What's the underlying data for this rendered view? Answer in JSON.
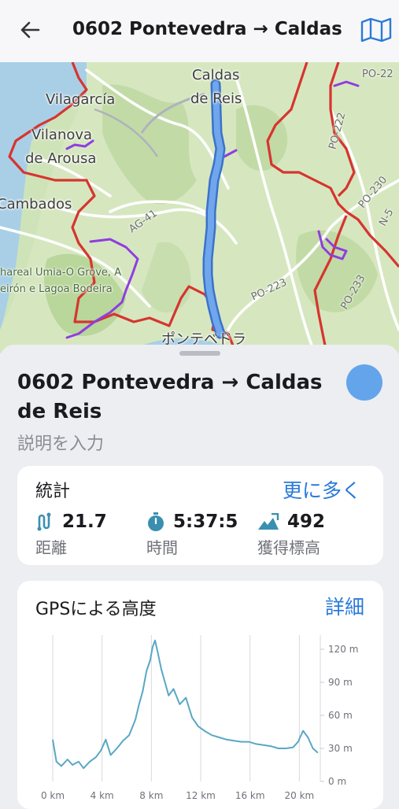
{
  "header": {
    "title": "0602 Pontevedra → Caldas de Reis",
    "back_icon": "arrow-left-icon",
    "map_icon": "map-icon"
  },
  "map": {
    "places": [
      {
        "name": "Caldas"
      },
      {
        "name": "de Reis"
      },
      {
        "name": "Vilagarcía"
      },
      {
        "name": "Vilanova"
      },
      {
        "name": "de Arousa"
      },
      {
        "name": "Cambados"
      },
      {
        "name": "ポンテベドラ"
      }
    ],
    "roads": [
      "PO-22",
      "PO-222",
      "PO-230",
      "N-5",
      "AG-41",
      "PO-223",
      "PO-233"
    ],
    "area_labels": [
      "hareal Umia-O Grove, A",
      "eirón e Lagoa Bodeira"
    ]
  },
  "sheet": {
    "track_name": "0602 Pontevedra → Caldas de Reis",
    "description_placeholder": "説明を入力",
    "color": "#64a4ea"
  },
  "stats": {
    "title": "統計",
    "more_link": "更に多く",
    "distance": {
      "value": "21.7",
      "label": "距離",
      "icon": "route-icon"
    },
    "time": {
      "value": "5:37:5",
      "label": "時間",
      "icon": "stopwatch-icon"
    },
    "ascent": {
      "value": "492",
      "label": "獲得標高",
      "icon": "ascent-icon"
    }
  },
  "elevation": {
    "title": "GPSによる高度",
    "details_link": "詳細"
  },
  "chart_data": {
    "type": "line",
    "x_unit": "km",
    "y_unit": "m",
    "x_ticks": [
      "0 km",
      "4 km",
      "8 km",
      "12 km",
      "16 km",
      "20 km"
    ],
    "y_ticks": [
      "0 m",
      "30 m",
      "60 m",
      "90 m",
      "120 m"
    ],
    "xlim": [
      0,
      21.7
    ],
    "ylim": [
      0,
      130
    ],
    "color": "#5aa7c4",
    "x": [
      0,
      0.3,
      0.7,
      1.2,
      1.6,
      2.1,
      2.5,
      3.0,
      3.5,
      3.9,
      4.3,
      4.7,
      5.2,
      5.7,
      6.2,
      6.7,
      7.0,
      7.3,
      7.6,
      7.9,
      8.1,
      8.3,
      8.5,
      8.8,
      9.1,
      9.4,
      9.8,
      10.3,
      10.8,
      11.3,
      11.8,
      12.3,
      12.9,
      13.5,
      14.1,
      14.7,
      15.3,
      15.9,
      16.5,
      17.1,
      17.7,
      18.3,
      18.9,
      19.5,
      19.9,
      20.3,
      20.7,
      21.1,
      21.5
    ],
    "y": [
      38,
      18,
      14,
      20,
      15,
      18,
      12,
      18,
      22,
      28,
      38,
      24,
      30,
      37,
      42,
      56,
      70,
      82,
      100,
      110,
      122,
      128,
      118,
      102,
      90,
      78,
      84,
      70,
      76,
      58,
      50,
      46,
      42,
      40,
      38,
      37,
      36,
      36,
      34,
      33,
      32,
      30,
      30,
      31,
      36,
      46,
      40,
      30,
      26
    ]
  }
}
